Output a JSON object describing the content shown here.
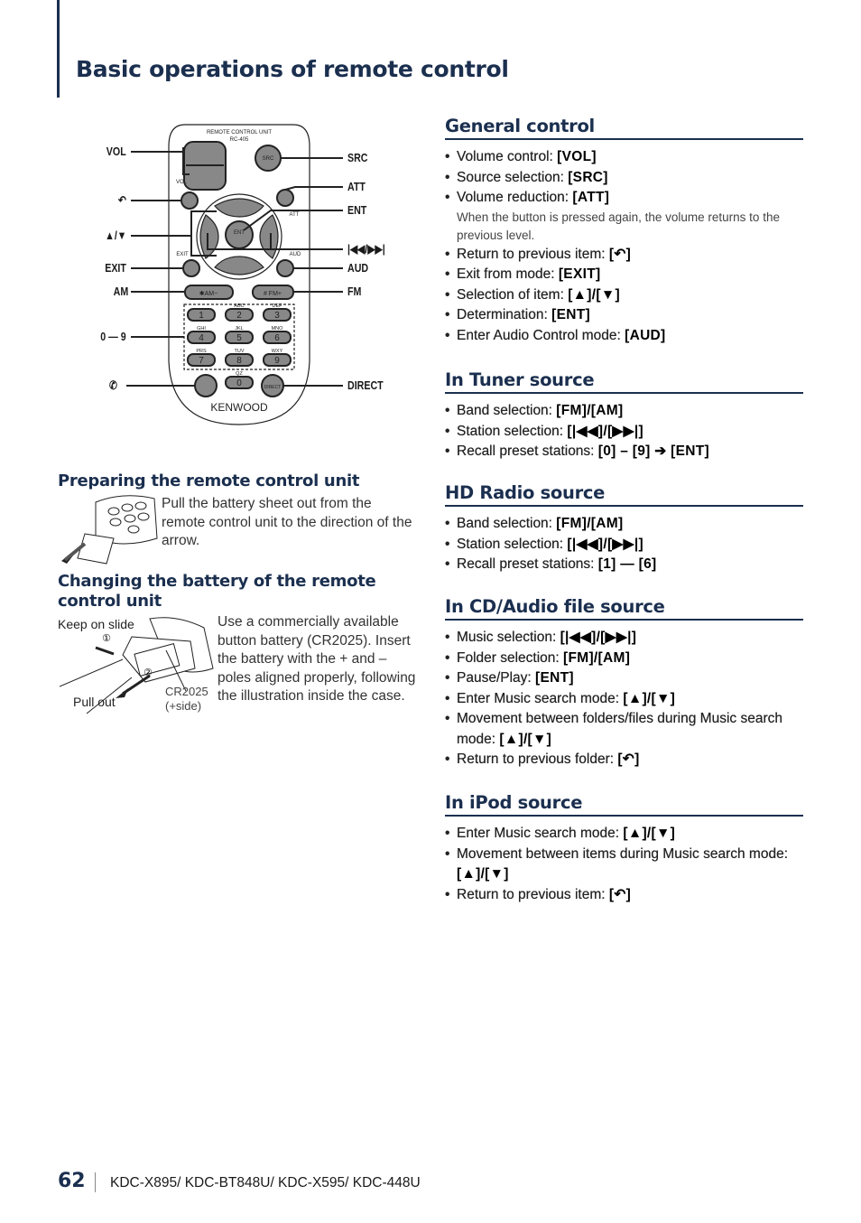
{
  "header": {
    "title": "Basic operations of remote control"
  },
  "remote": {
    "unit_text": "REMOTE CONTROL UNIT",
    "model": "RC-405",
    "brand": "KENWOOD",
    "buttons": {
      "src": "SRC",
      "vol": "VOL",
      "ent": "ENT",
      "exit": "EXIT",
      "aud": "AUD",
      "att": "ATT",
      "am": "✱AM−",
      "fm": "# FM+",
      "direct": "DIRECT",
      "numbers": [
        "1",
        "2",
        "3",
        "4",
        "5",
        "6",
        "7",
        "8",
        "9",
        "0"
      ],
      "letters": [
        "",
        "ABC",
        "DEF",
        "GHI",
        "JKL",
        "MNO",
        "PRS",
        "TUV",
        "WXY",
        "QZ"
      ]
    },
    "callouts": {
      "vol": "VOL",
      "back": "↶",
      "updown": "▲/▼",
      "exit": "EXIT",
      "am": "AM",
      "digits": "0 — 9",
      "phone": "✆",
      "src": "SRC",
      "att": "ATT",
      "ent": "ENT",
      "track": "|◀◀/▶▶|",
      "aud": "AUD",
      "fm": "FM",
      "direct": "DIRECT"
    }
  },
  "preparing": {
    "heading": "Preparing the remote control unit",
    "text": "Pull the battery sheet out from the remote control unit to the direction of the arrow."
  },
  "battery": {
    "heading": "Changing the battery of the remote control unit",
    "keep": "Keep on slide",
    "pull": "Pull out",
    "step1": "①",
    "step2": "②",
    "cr": "CR2025",
    "side": "(+side)",
    "text": "Use a commercially available button battery (CR2025). Insert the battery with the + and – poles aligned properly, following the illustration inside the case."
  },
  "sections": [
    {
      "title": "General control",
      "items": [
        {
          "label": "Volume control: ",
          "value": "[VOL]"
        },
        {
          "label": "Source selection: ",
          "value": "[SRC]"
        },
        {
          "label": "Volume reduction: ",
          "value": "[ATT]",
          "note": "When the button is pressed again, the volume returns to the previous level."
        },
        {
          "label": "Return to previous item: ",
          "value": "[↶]"
        },
        {
          "label": "Exit from mode: ",
          "value": "[EXIT]"
        },
        {
          "label": "Selection of item: ",
          "value": "[▲]/[▼]"
        },
        {
          "label": "Determination: ",
          "value": "[ENT]"
        },
        {
          "label": "Enter Audio Control mode: ",
          "value": "[AUD]"
        }
      ]
    },
    {
      "title": "In Tuner source",
      "items": [
        {
          "label": "Band selection: ",
          "value": "[FM]/[AM]"
        },
        {
          "label": "Station selection: ",
          "value": "[|◀◀]/[▶▶|]"
        },
        {
          "label": "Recall preset stations: ",
          "value": "[0] – [9] ➔ [ENT]"
        }
      ]
    },
    {
      "title": "HD Radio source",
      "items": [
        {
          "label": "Band selection: ",
          "value": "[FM]/[AM]"
        },
        {
          "label": "Station selection: ",
          "value": "[|◀◀]/[▶▶|]"
        },
        {
          "label": "Recall preset stations: ",
          "value": "[1] — [6]"
        }
      ]
    },
    {
      "title": "In CD/Audio file source",
      "items": [
        {
          "label": "Music selection: ",
          "value": "[|◀◀]/[▶▶|]"
        },
        {
          "label": "Folder selection: ",
          "value": "[FM]/[AM]"
        },
        {
          "label": "Pause/Play: ",
          "value": "[ENT]"
        },
        {
          "label": "Enter Music search mode: ",
          "value": "[▲]/[▼]"
        },
        {
          "label": "Movement between folders/files during Music search mode: ",
          "value": "[▲]/[▼]"
        },
        {
          "label": "Return to previous folder: ",
          "value": "[↶]"
        }
      ]
    },
    {
      "title": "In iPod source",
      "items": [
        {
          "label": "Enter Music search mode: ",
          "value": "[▲]/[▼]"
        },
        {
          "label": "Movement between items during Music search mode: ",
          "value": "[▲]/[▼]"
        },
        {
          "label": "Return to previous item: ",
          "value": "[↶]"
        }
      ]
    }
  ],
  "footer": {
    "page": "62",
    "models": "KDC-X895/ KDC-BT848U/ KDC-X595/ KDC-448U"
  }
}
